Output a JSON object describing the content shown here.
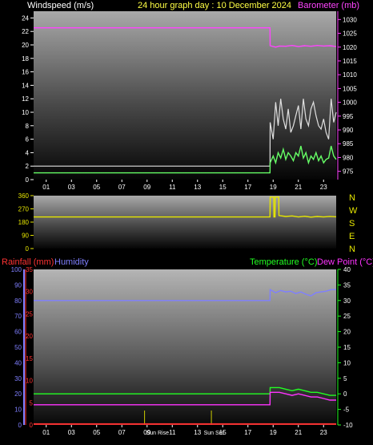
{
  "header": {
    "windspeed_label": "Windspeed (m/s)",
    "title": "24 hour graph day : 10 December 2024",
    "barometer_label": "Barometer (mb)"
  },
  "legend": {
    "rainfall_label": "Rainfall (mm)",
    "humidity_label": "Humidity",
    "temperature_label": "Temperature (°C)",
    "dewpoint_label": "Dew Point (°C)"
  },
  "direction_labels": [
    "N",
    "W",
    "S",
    "E",
    "N"
  ],
  "sun_labels": {
    "sunrise": "Sun Rise",
    "sunset": "Sun Set"
  },
  "colors": {
    "windspeed": "#e0e0e0",
    "gust": "#ffffff",
    "avg_wind": "#66ff66",
    "barometer": "#ff44ff",
    "title": "#ffff44",
    "direction": "#e6e600",
    "rainfall": "#ff3333",
    "humidity": "#7f7fff",
    "temperature": "#22ff22",
    "dewpoint": "#ff33ff",
    "sun": "#cccc00"
  },
  "chart_data": [
    {
      "type": "line",
      "name": "wind-baro",
      "x_ticks": [
        "01",
        "03",
        "05",
        "07",
        "09",
        "11",
        "13",
        "15",
        "17",
        "19",
        "21",
        "23"
      ],
      "xlim": [
        0,
        24
      ],
      "y_left": {
        "ticks": [
          "0",
          "2",
          "4",
          "6",
          "8",
          "10",
          "12",
          "14",
          "16",
          "18",
          "20",
          "22",
          "24"
        ],
        "ylim": [
          0,
          25
        ]
      },
      "y_right": {
        "ticks": [
          "975",
          "980",
          "985",
          "990",
          "995",
          "1000",
          "1005",
          "1010",
          "1015",
          "1020",
          "1025",
          "1030"
        ],
        "ylim": [
          972,
          1033
        ]
      },
      "series": [
        {
          "key": "barometer",
          "axis": "right",
          "x": [
            0,
            18.75,
            18.76,
            19.2,
            19.5,
            20,
            20.5,
            21,
            21.5,
            22,
            22.5,
            23,
            23.5,
            24
          ],
          "y": [
            1027,
            1027,
            1020.5,
            1020,
            1020.4,
            1020.3,
            1020.6,
            1020.2,
            1020.5,
            1020.3,
            1020.6,
            1020.4,
            1020.5,
            1020.2
          ]
        },
        {
          "key": "windspeed",
          "axis": "left",
          "x": [
            0,
            18.75,
            18.76,
            19.0,
            19.2,
            19.4,
            19.6,
            19.8,
            20.0,
            20.2,
            20.4,
            20.6,
            20.8,
            21.0,
            21.2,
            21.4,
            21.6,
            21.8,
            22.0,
            22.2,
            22.4,
            22.6,
            22.8,
            23.0,
            23.2,
            23.4,
            23.6,
            23.8,
            24.0
          ],
          "y": [
            2,
            2,
            8.5,
            6,
            11.5,
            8,
            12,
            9,
            7.5,
            10.5,
            7,
            8,
            9.5,
            11,
            7.5,
            12,
            9,
            8,
            10.5,
            11.5,
            9.5,
            8,
            7.5,
            9,
            7,
            6,
            12,
            8.5,
            10
          ]
        },
        {
          "key": "avg_wind",
          "axis": "left",
          "x": [
            0,
            18.75,
            18.76,
            19.0,
            19.2,
            19.4,
            19.6,
            19.8,
            20.0,
            20.2,
            20.4,
            20.6,
            20.8,
            21.0,
            21.2,
            21.4,
            21.6,
            21.8,
            22.0,
            22.2,
            22.4,
            22.6,
            22.8,
            23.0,
            23.2,
            23.4,
            23.6,
            23.8,
            24.0
          ],
          "y": [
            1,
            1,
            2.5,
            3.5,
            2.5,
            4,
            3.2,
            4.5,
            3,
            4,
            3.5,
            2.8,
            4,
            3.5,
            5,
            3.2,
            4,
            2.5,
            3.5,
            3,
            4,
            2.8,
            3.5,
            2.5,
            3,
            3.2,
            5,
            3.5,
            3
          ]
        }
      ]
    },
    {
      "type": "line",
      "name": "wind-direction",
      "xlim": [
        0,
        24
      ],
      "y_ticks": [
        "0",
        "90",
        "180",
        "270",
        "360"
      ],
      "ylim": [
        0,
        360
      ],
      "series": [
        {
          "key": "direction",
          "x": [
            0,
            18.75,
            18.76,
            19.05,
            19.06,
            19.15,
            19.16,
            19.45,
            19.46,
            20,
            20.5,
            21,
            21.5,
            22,
            22.5,
            23,
            23.5,
            24
          ],
          "y": [
            215,
            215,
            350,
            350,
            215,
            215,
            350,
            350,
            225,
            218,
            222,
            215,
            220,
            214,
            218,
            215,
            219,
            216
          ]
        }
      ]
    },
    {
      "type": "line",
      "name": "rain-humidity-temperature",
      "x_ticks": [
        "01",
        "03",
        "05",
        "07",
        "09",
        "11",
        "13",
        "15",
        "17",
        "19",
        "21",
        "23"
      ],
      "xlim": [
        0,
        24
      ],
      "y_left_humidity": {
        "ticks": [
          "0",
          "10",
          "20",
          "30",
          "40",
          "50",
          "60",
          "70",
          "80",
          "90",
          "100"
        ],
        "ylim": [
          0,
          100
        ]
      },
      "y_left_rainfall": {
        "ticks": [
          "0",
          "5",
          "10",
          "15",
          "20",
          "25",
          "30",
          "35"
        ],
        "ylim": [
          0,
          35
        ]
      },
      "y_right": {
        "ticks": [
          "-10",
          "-5",
          "0",
          "5",
          "10",
          "15",
          "20",
          "25",
          "30",
          "35",
          "40"
        ],
        "ylim": [
          -10,
          40
        ]
      },
      "sunrise_hour": 8.8,
      "sunset_hour": 14.1,
      "series": [
        {
          "key": "rainfall",
          "axis": "rainfall",
          "x": [
            0,
            24
          ],
          "y": [
            0.2,
            0.2
          ]
        },
        {
          "key": "humidity",
          "axis": "humidity",
          "x": [
            0,
            18.75,
            18.76,
            19.2,
            19.6,
            20,
            20.4,
            20.8,
            21.2,
            21.6,
            22,
            22.4,
            22.8,
            23.2,
            23.6,
            24
          ],
          "y": [
            80,
            80,
            87,
            85,
            86.5,
            85.5,
            86,
            84.5,
            85.5,
            84,
            83,
            85,
            85.5,
            86,
            87,
            87
          ]
        },
        {
          "key": "temperature",
          "axis": "right",
          "x": [
            0,
            18.75,
            18.76,
            19.5,
            20,
            20.5,
            21,
            21.5,
            22,
            22.5,
            23,
            23.5,
            24
          ],
          "y": [
            0,
            0,
            2,
            2,
            1.5,
            1,
            1.5,
            1,
            0.5,
            0.5,
            0,
            -0.5,
            -0.5
          ]
        },
        {
          "key": "dewpoint",
          "axis": "right",
          "x": [
            0,
            18.75,
            18.76,
            19.5,
            20,
            20.5,
            21,
            21.5,
            22,
            22.5,
            23,
            23.5,
            24
          ],
          "y": [
            -3.5,
            -3.5,
            0.5,
            0.5,
            0,
            -0.5,
            0,
            -0.5,
            -1,
            -1,
            -1.5,
            -2,
            -2
          ]
        }
      ]
    }
  ]
}
